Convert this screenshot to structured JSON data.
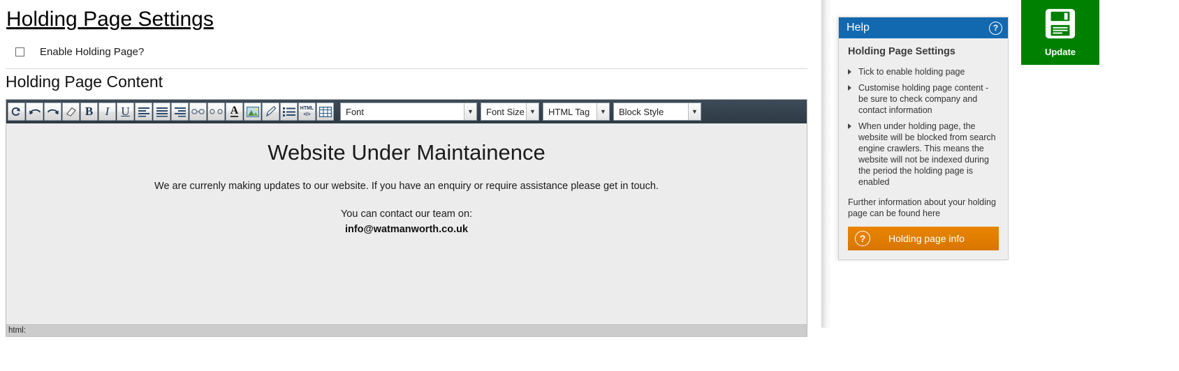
{
  "page": {
    "title": "Holding Page Settings",
    "enable_checkbox_label": "Enable Holding Page?",
    "enable_checkbox_checked": false,
    "content_section_title": "Holding Page Content"
  },
  "editor": {
    "toolbar_buttons": [
      {
        "name": "redo-circular-icon",
        "glyph": "↺"
      },
      {
        "name": "undo-arrow-icon",
        "glyph": "↶"
      },
      {
        "name": "redo-arrow-icon",
        "glyph": "↷"
      },
      {
        "name": "eraser-icon",
        "glyph": "▱"
      },
      {
        "name": "bold-icon",
        "glyph": "B"
      },
      {
        "name": "italic-icon",
        "glyph": "I"
      },
      {
        "name": "underline-icon",
        "glyph": "U"
      },
      {
        "name": "align-left-icon",
        "glyph": "≡"
      },
      {
        "name": "align-justify-icon",
        "glyph": "≡"
      },
      {
        "name": "align-right-icon",
        "glyph": "≡"
      },
      {
        "name": "insert-link-icon",
        "glyph": "⚭"
      },
      {
        "name": "remove-link-icon",
        "glyph": "⚭"
      },
      {
        "name": "font-color-icon",
        "glyph": "A"
      },
      {
        "name": "insert-image-icon",
        "glyph": "⛰"
      },
      {
        "name": "format-painter-icon",
        "glyph": "✐"
      },
      {
        "name": "bullet-list-icon",
        "glyph": "☰"
      },
      {
        "name": "html-source-icon",
        "glyph": "HTML"
      },
      {
        "name": "insert-table-icon",
        "glyph": "⊞"
      }
    ],
    "selects": [
      {
        "name": "font-family-select",
        "value": "Font"
      },
      {
        "name": "font-size-select",
        "value": "Font Size"
      },
      {
        "name": "html-tag-select",
        "value": "HTML Tag"
      },
      {
        "name": "block-style-select",
        "value": "Block Style"
      }
    ],
    "content": {
      "heading": "Website Under Maintainence",
      "paragraph": "We are currenly making updates to our website. If you have an enquiry or require assistance please get in touch.",
      "contact_line": "You can contact our team on:",
      "email": "info@watmanworth.co.uk"
    },
    "status_bar": "html:"
  },
  "help": {
    "header_title": "Help",
    "header_icon_glyph": "?",
    "subtitle": "Holding Page Settings",
    "bullets": [
      "Tick to enable holding page",
      "Customise holding page content - be sure to check company and contact information",
      "When under holding page, the website will be blocked from search engine crawlers. This means the website will not be indexed during the period the holding page is enabled"
    ],
    "note": "Further information about your holding page can be found here",
    "button_label": "Holding page info",
    "button_icon_glyph": "?",
    "button_color": "#dd7b00",
    "header_color": "#1269b0"
  },
  "update": {
    "label": "Update",
    "color": "#008000",
    "icon": "floppy-disk-save-icon"
  }
}
